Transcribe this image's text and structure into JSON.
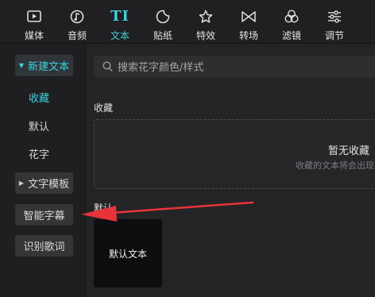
{
  "toolbar": {
    "items": [
      {
        "label": "媒体",
        "icon": "media-icon"
      },
      {
        "label": "音频",
        "icon": "audio-icon"
      },
      {
        "label": "文本",
        "icon": "text-icon",
        "active": true
      },
      {
        "label": "贴纸",
        "icon": "sticker-icon"
      },
      {
        "label": "特效",
        "icon": "effects-icon"
      },
      {
        "label": "转场",
        "icon": "transition-icon"
      },
      {
        "label": "滤镜",
        "icon": "filter-icon"
      },
      {
        "label": "调节",
        "icon": "adjust-icon"
      }
    ],
    "text_icon_glyph": "TI"
  },
  "sidebar": {
    "new_text": "新建文本",
    "favorites": "收藏",
    "default": "默认",
    "fancy": "花字",
    "templates": "文字模板",
    "smart_subtitles": "智能字幕",
    "recognize_lyrics": "识别歌词"
  },
  "search": {
    "placeholder": "搜索花字颜色/样式"
  },
  "main": {
    "favorites_title": "收藏",
    "favorites_empty": "暂无收藏",
    "favorites_hint": "收藏的文本将会出现",
    "default_title": "默认",
    "default_preset": "默认文本"
  },
  "colors": {
    "accent": "#3fd1d9",
    "annotation_arrow": "#e8333a"
  }
}
